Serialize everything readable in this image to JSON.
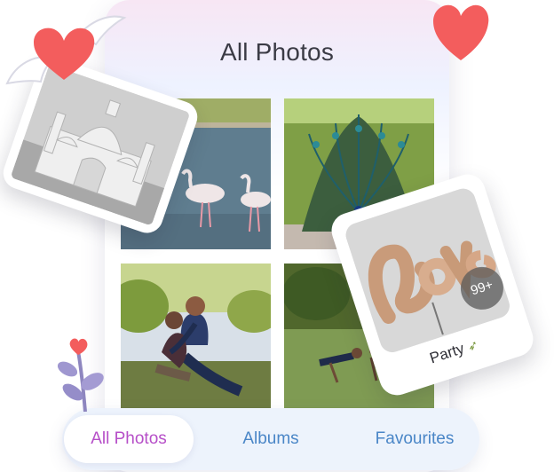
{
  "header": {
    "title": "All Photos"
  },
  "tabs": [
    {
      "label": "All Photos",
      "active": true
    },
    {
      "label": "Albums",
      "active": false
    },
    {
      "label": "Favourites",
      "active": false
    }
  ],
  "album_card": {
    "label": "Party",
    "count_badge": "99+"
  },
  "colors": {
    "active_tab_text": "#b64fc8",
    "inactive_tab_text": "#4a86c7",
    "heart": "#f35d5d",
    "title_text": "#3b3b45"
  },
  "icons": {
    "winged_heart": "winged-heart-icon",
    "heart": "heart-icon",
    "plant": "plant-icon",
    "party_popper": "party-popper-icon"
  }
}
